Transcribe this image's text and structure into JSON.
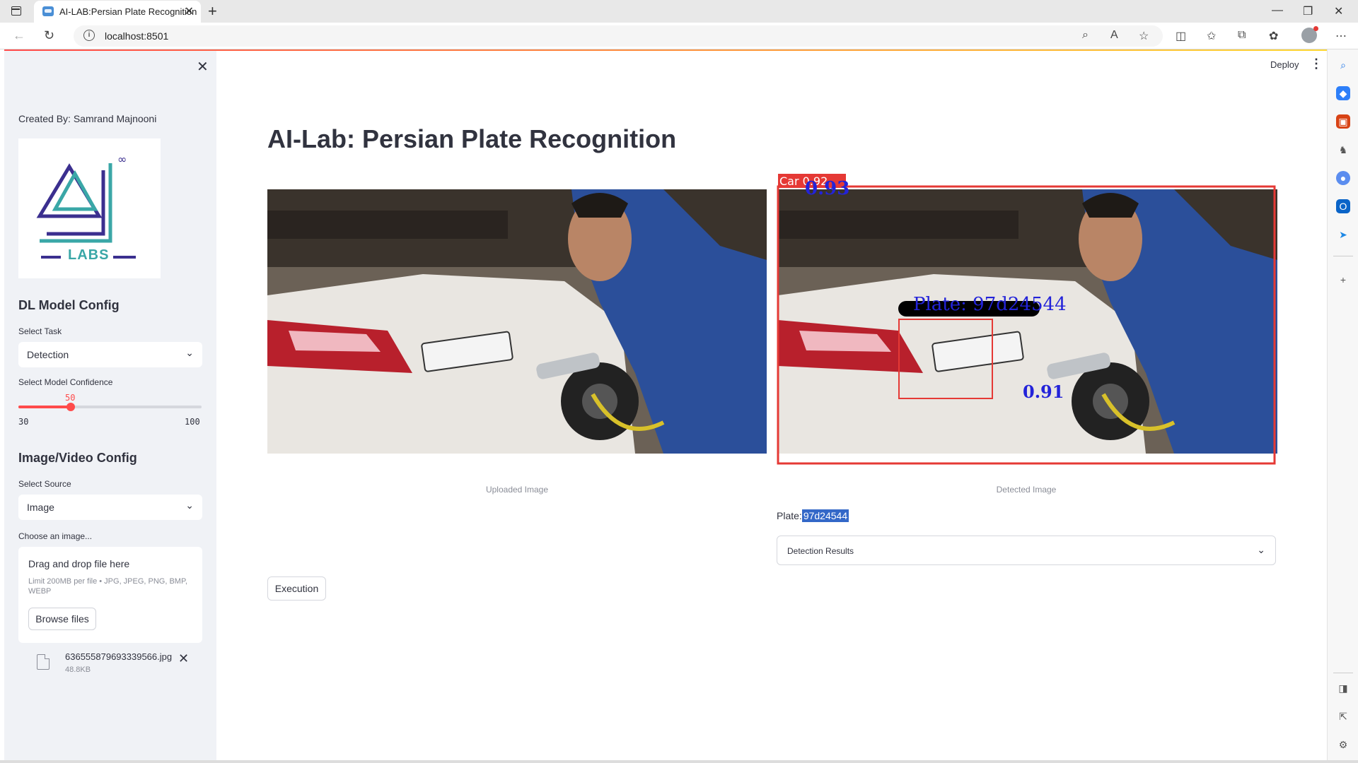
{
  "browser": {
    "tab_title": "AI-LAB:Persian Plate Recognition",
    "url": "localhost:8501"
  },
  "header": {
    "deploy_label": "Deploy"
  },
  "sidebar": {
    "created_by": "Created By: Samrand Majnooni",
    "logo_text": "LABS",
    "model_config_heading": "DL Model Config",
    "task_label": "Select Task",
    "task_value": "Detection",
    "confidence_label": "Select Model Confidence",
    "confidence_value": "50",
    "confidence_min": "30",
    "confidence_max": "100",
    "confidence_fraction": 0.2857,
    "media_config_heading": "Image/Video Config",
    "source_label": "Select Source",
    "source_value": "Image",
    "upload_label": "Choose an image...",
    "dropzone_title": "Drag and drop file here",
    "dropzone_limits": "Limit 200MB per file • JPG, JPEG, PNG, BMP, WEBP",
    "browse_label": "Browse files",
    "file_name": "636555879693339566.jpg",
    "file_size": "48.8KB"
  },
  "main": {
    "title": "AI-Lab: Persian Plate Recognition",
    "uploaded_caption": "Uploaded Image",
    "detected_caption": "Detected Image",
    "car_box_label": "Car 0.92",
    "car_conf": "0.93",
    "plate_box_label": "Plate: 97d24544",
    "plate_conf": "0.91",
    "plate_prefix": "Plate:",
    "plate_value": "97d24544",
    "expander_label": "Detection Results",
    "execute_label": "Execution"
  },
  "colors": {
    "accent": "#ff4b4b",
    "sidebar_bg": "#f0f2f6",
    "highlight": "#3368c8"
  }
}
